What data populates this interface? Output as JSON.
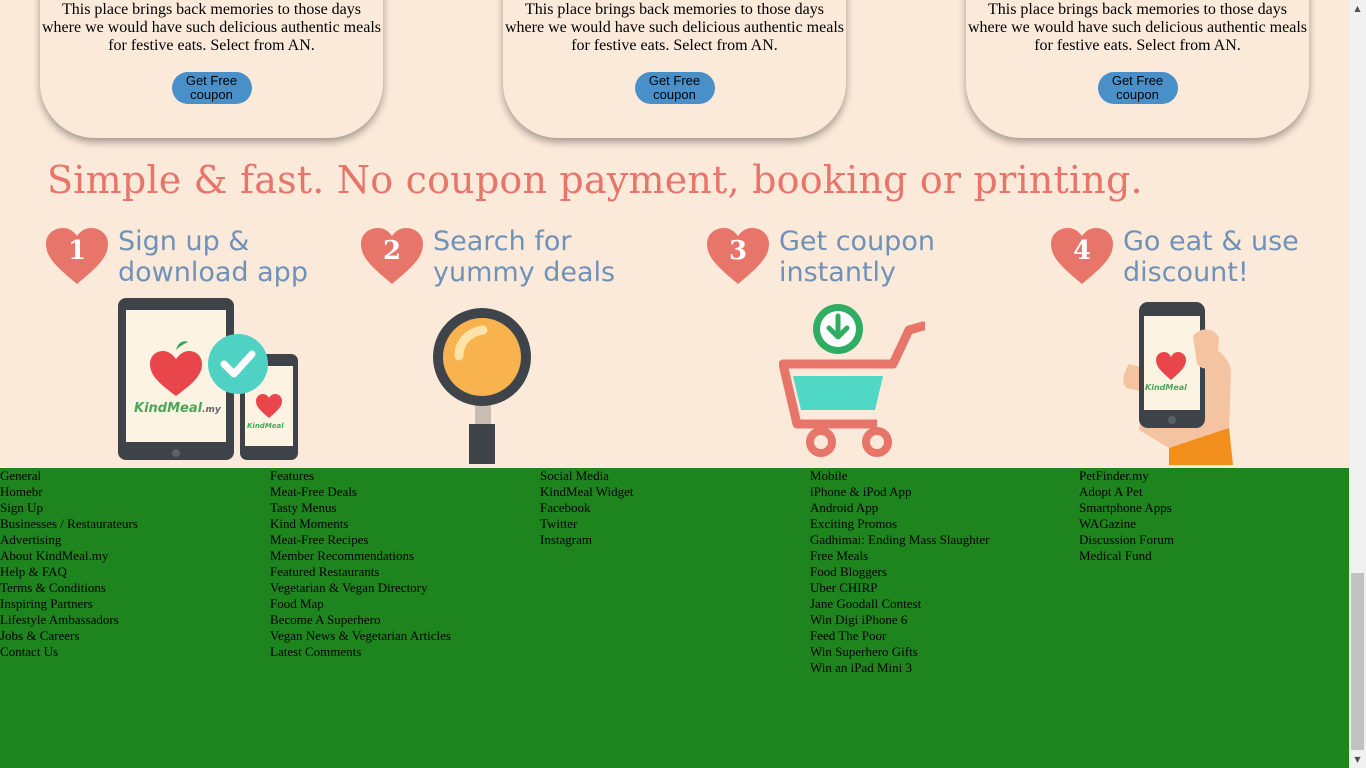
{
  "cards": [
    {
      "description": "This place brings back memories to those days where we would have such delicious authentic meals for festive eats. Select from AN.",
      "button": "Get Free coupon"
    },
    {
      "description": "This place brings back memories to those days where we would have such delicious authentic meals for festive eats. Select from AN.",
      "button": "Get Free coupon"
    },
    {
      "description": "This place brings back memories to those days where we would have such delicious authentic meals for festive eats. Select from AN.",
      "button": "Get Free coupon"
    }
  ],
  "banner": {
    "headline": "Simple & fast.  No coupon payment, booking or printing.",
    "steps": [
      {
        "number": "1",
        "title": "Sign up & download app"
      },
      {
        "number": "2",
        "title": "Search for yummy deals"
      },
      {
        "number": "3",
        "title": "Get coupon instantly"
      },
      {
        "number": "4",
        "title": "Go eat & use discount!"
      }
    ],
    "logo_text": "KindMeal",
    "logo_suffix": ".my"
  },
  "footer": {
    "columns": [
      [
        "General",
        "Homebr",
        "Sign Up",
        "Businesses / Restaurateurs",
        "Advertising",
        "About KindMeal.my",
        "Help & FAQ",
        "Terms & Conditions",
        "Inspiring Partners",
        "Lifestyle Ambassadors",
        "Jobs & Careers",
        "Contact Us"
      ],
      [
        "Features",
        "Meat-Free Deals",
        "Tasty Menus",
        "Kind Moments",
        "Meat-Free Recipes",
        "Member Recommendations",
        "Featured Restaurants",
        "Vegetarian & Vegan Directory",
        "Food Map",
        "Become A Superhero",
        "Vegan News & Vegetarian Articles",
        "Latest Comments"
      ],
      [
        "Social Media",
        "KindMeal Widget",
        "Facebook",
        "Twitter",
        "Instagram"
      ],
      [
        "Mobile",
        "iPhone & iPod App",
        "Android App",
        "Exciting Promos",
        "Gadhimai: Ending Mass Slaughter",
        "Free Meals",
        "Food Bloggers",
        "Uber CHIRP",
        "Jane Goodall Contest",
        "Win Digi iPhone 6",
        "Feed The Poor",
        "Win Superhero Gifts",
        "Win an iPad Mini 3"
      ],
      [
        "PetFinder.my",
        "Adopt A Pet",
        "Smartphone Apps",
        "WAGazine",
        "Discussion Forum",
        "Medical Fund"
      ]
    ]
  },
  "colors": {
    "background": "#fbe9d9",
    "footer": "#1e841e",
    "coupon_button": "#4a90c8",
    "headline": "#e8756a",
    "step_title": "#7092b8"
  }
}
